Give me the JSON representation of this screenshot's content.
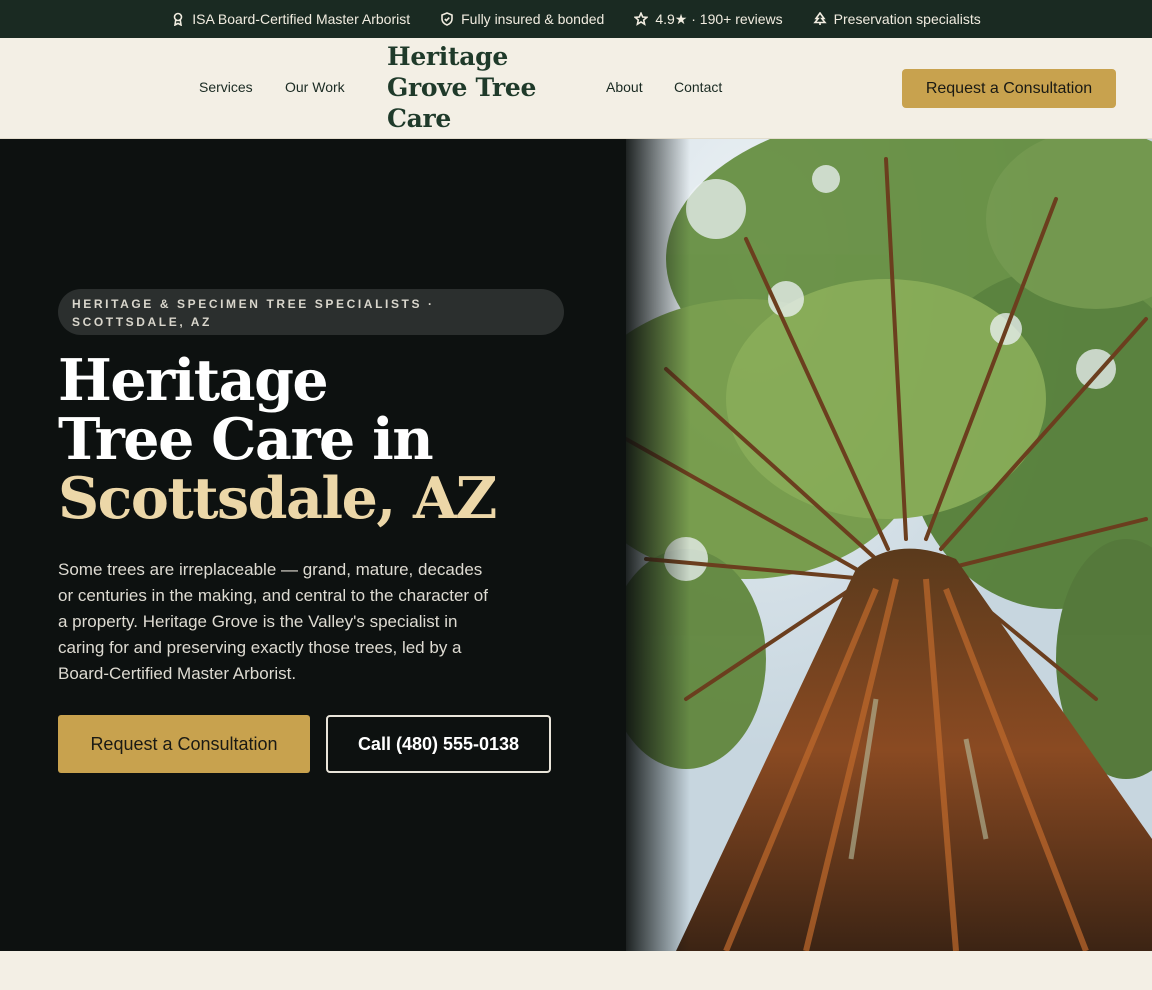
{
  "topbar": {
    "items": [
      {
        "icon": "award-icon",
        "text": "ISA Board-Certified Master Arborist"
      },
      {
        "icon": "shield-icon",
        "text": "Fully insured & bonded"
      },
      {
        "icon": "star-icon",
        "text": "4.9★ · 190+ reviews"
      },
      {
        "icon": "tree-icon",
        "text": "Preservation specialists"
      }
    ]
  },
  "nav": {
    "links": [
      "Services",
      "Our Work",
      "About",
      "Contact"
    ],
    "logo": "Heritage Grove Tree Care",
    "cta": "Request a Consultation"
  },
  "hero": {
    "eyebrow": "HERITAGE & SPECIMEN TREE SPECIALISTS · SCOTTSDALE, AZ",
    "headline_line1": "Heritage",
    "headline_line2": "Tree Care in",
    "headline_accent": "Scottsdale, AZ",
    "lead": "Some trees are irreplaceable — grand, mature, decades or centuries in the making, and central to the character of a property. Heritage Grove is the Valley's specialist in caring for and preserving exactly those trees, led by a Board-Certified Master Arborist.",
    "primary_button": "Request a Consultation",
    "secondary_button": "Call (480) 555-0138",
    "image_subject": "tree-canopy-photo"
  },
  "colors": {
    "topbar_bg": "#1a2a22",
    "nav_bg": "#f3efe5",
    "hero_bg": "#0d1110",
    "accent_gold": "#c8a24e",
    "accent_text": "#ecd7a8"
  }
}
